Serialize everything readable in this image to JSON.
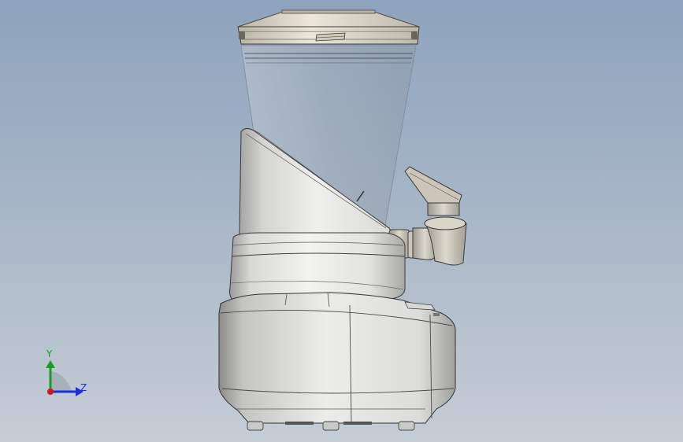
{
  "viewport": {
    "background_top": "#8ea3bc",
    "background_bottom": "#c5cdd6"
  },
  "model": {
    "name": "",
    "parts": [
      "lid",
      "hopper",
      "shroud",
      "spout",
      "collar",
      "base",
      "feet"
    ]
  },
  "triad": {
    "y_label": "Y",
    "z_label": "Z",
    "y_color": "#1a9a2a",
    "z_color": "#1c2fd6",
    "x_color": "#d01818"
  }
}
